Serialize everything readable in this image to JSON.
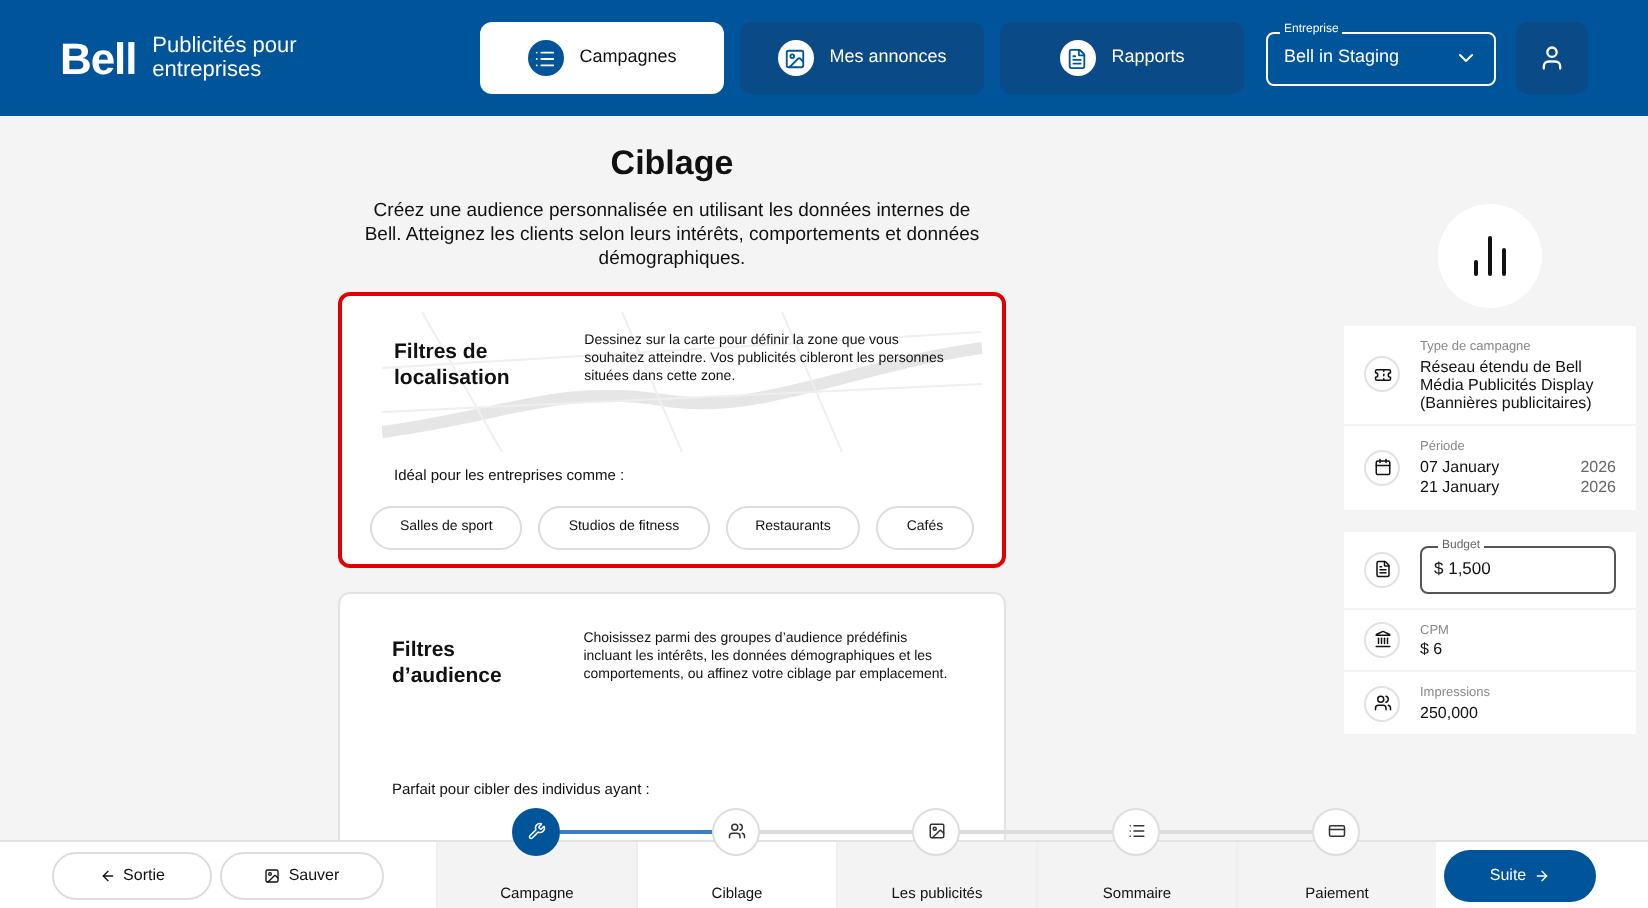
{
  "header": {
    "logo": "Bell",
    "brand": "Publicités pour entreprises",
    "tabs": [
      {
        "label": "Campagnes",
        "selected": true
      },
      {
        "label": "Mes annonces",
        "selected": false
      },
      {
        "label": "Rapports",
        "selected": false
      }
    ],
    "company_select": {
      "label": "Entreprise",
      "value": "Bell in Staging"
    }
  },
  "main": {
    "title": "Ciblage",
    "intro": "Créez une audience personnalisée en utilisant les données internes de Bell. Atteignez les clients selon leurs intérêts, comportements et données démographiques.",
    "cards": [
      {
        "title": "Filtres de localisation",
        "description": "Dessinez sur la carte pour définir la zone que vous souhaitez atteindre. Vos publicités cibleront les personnes situées dans cette zone.",
        "highlighted": true,
        "map": true,
        "subtitle": "Idéal pour les entreprises comme :",
        "chips": [
          "Salles de sport",
          "Studios de fitness",
          "Restaurants",
          "Cafés"
        ]
      },
      {
        "title": "Filtres d’audience",
        "description": "Choisissez parmi des groupes d’audience prédéfinis incluant les intérêts, les données démographiques et les comportements, ou affinez votre ciblage par emplacement.",
        "highlighted": false,
        "subtitle": "Parfait pour cibler des individus ayant :"
      }
    ]
  },
  "summary": {
    "items": [
      {
        "kind": "text",
        "label": "Type de campagne",
        "value": "Réseau étendu de Bell Média Publicités Display (Bannières publicitaires)"
      },
      {
        "kind": "period",
        "label": "Période",
        "dates": [
          {
            "day": "07 January",
            "year": "2026"
          },
          {
            "day": "21 January",
            "year": "2026"
          }
        ]
      },
      {
        "kind": "input",
        "label": "Budget",
        "value": "$ 1,500"
      },
      {
        "kind": "text",
        "label": "CPM",
        "value": "$ 6"
      },
      {
        "kind": "text",
        "label": "Impressions",
        "value": "250,000"
      }
    ]
  },
  "footer": {
    "exit": "Sortie",
    "save": "Sauver",
    "next": "Suite",
    "steps": [
      {
        "label": "Campagne",
        "done": true,
        "selected": false
      },
      {
        "label": "Ciblage",
        "done": false,
        "selected": true
      },
      {
        "label": "Les publicités",
        "done": false,
        "selected": false
      },
      {
        "label": "Sommaire",
        "done": false,
        "selected": false
      },
      {
        "label": "Paiement",
        "done": false,
        "selected": false
      }
    ]
  }
}
